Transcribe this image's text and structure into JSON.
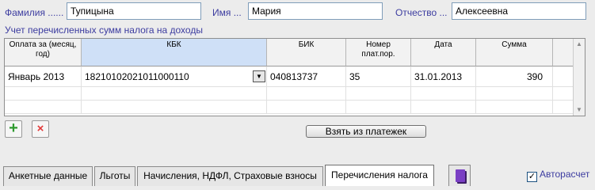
{
  "person": {
    "surname_label": "Фамилия",
    "surname_value": "Тупицына",
    "name_label": "Имя",
    "name_value": "Мария",
    "patronymic_label": "Отчество",
    "patronymic_value": "Алексеевна"
  },
  "section_title": "Учет перечисленных сумм налога на доходы",
  "grid": {
    "headers": [
      "Оплата за (месяц, год)",
      "КБК",
      "БИК",
      "Номер плат.пор.",
      "Дата",
      "Сумма"
    ],
    "rows": [
      [
        "Январь 2013",
        "18210102021011000110",
        "040813737",
        "35",
        "31.01.2013",
        "390"
      ]
    ],
    "selected_header": "КБК"
  },
  "buttons": {
    "add_icon": "plus-icon",
    "add_glyph": "+",
    "delete_icon": "close-icon",
    "delete_glyph": "×",
    "take_from_payments": "Взять из платежек"
  },
  "tabs": [
    {
      "label": "Анкетные данные",
      "active": false
    },
    {
      "label": "Льготы",
      "active": false
    },
    {
      "label": "Начисления, НДФЛ, Страховые взносы",
      "active": false
    },
    {
      "label": "Перечисления налога",
      "active": true
    }
  ],
  "book_tab_icon": "book-icon",
  "autocalc": {
    "label": "Авторасчет",
    "checked": true,
    "check_glyph": "✓"
  },
  "colors": {
    "label_blue": "#3c3ca0",
    "add_green": "#2f9a2f",
    "delete_red": "#e23a3a",
    "book_purple": "#7a3fc4"
  }
}
